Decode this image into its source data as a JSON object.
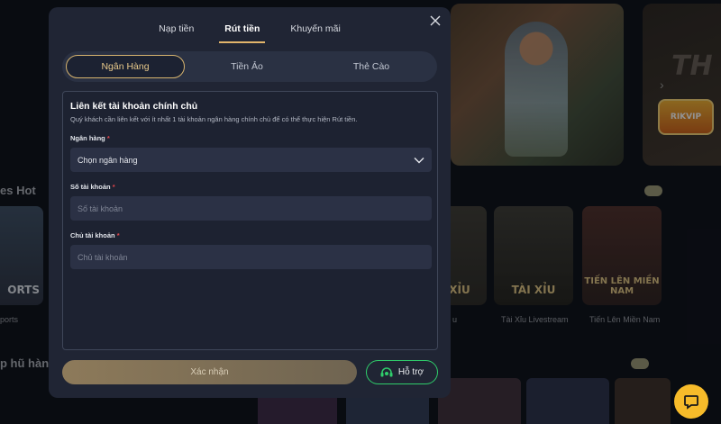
{
  "modal": {
    "tabs": [
      {
        "label": "Nạp tiền"
      },
      {
        "label": "Rút tiền"
      },
      {
        "label": "Khuyến mãi"
      }
    ],
    "active_tab": 1,
    "methods": [
      {
        "label": "Ngân Hàng"
      },
      {
        "label": "Tiền Ảo"
      },
      {
        "label": "Thẻ Cào"
      }
    ],
    "active_method": 0,
    "panel": {
      "title": "Liên kết tài khoản chính chủ",
      "description": "Quý khách cần liên kết với ít nhất 1 tài khoản ngân hàng chính chủ để có thể thực hiện Rút tiền.",
      "bank_label": "Ngân hàng",
      "bank_value": "Chọn ngân hàng",
      "account_number_label": "Số tài khoản",
      "account_number_placeholder": "Số tài khoản",
      "account_holder_label": "Chủ tài khoản",
      "account_holder_placeholder": "Chủ tài khoản",
      "required_mark": "*"
    },
    "submit_label": "Xác nhận",
    "support_label": "Hỗ trợ",
    "icons": {
      "close": "close-icon",
      "chevron": "chevron-down-icon",
      "support": "headset-icon"
    },
    "colors": {
      "accent": "#e2b56b",
      "support_border": "#2fce6b",
      "required": "#e0454b"
    }
  },
  "background": {
    "section_hot": "es Hot",
    "section_jackpot": "p hũ hàng",
    "banner_text": "TH",
    "logo_text": "RIKVIP",
    "card_sports_label": "ORTS",
    "card_sports_caption": "ports",
    "card_xiu_label": "XỈU",
    "card_xiu_caption": "u",
    "card_taixiu_label": "TÀI XỈU",
    "card_taixiu_caption": "Tài Xỉu Livestream",
    "card_tienlen_label": "TIẾN LÊN MIỀN NAM",
    "card_tienlen_caption": "Tiến Lên Miền Nam"
  }
}
